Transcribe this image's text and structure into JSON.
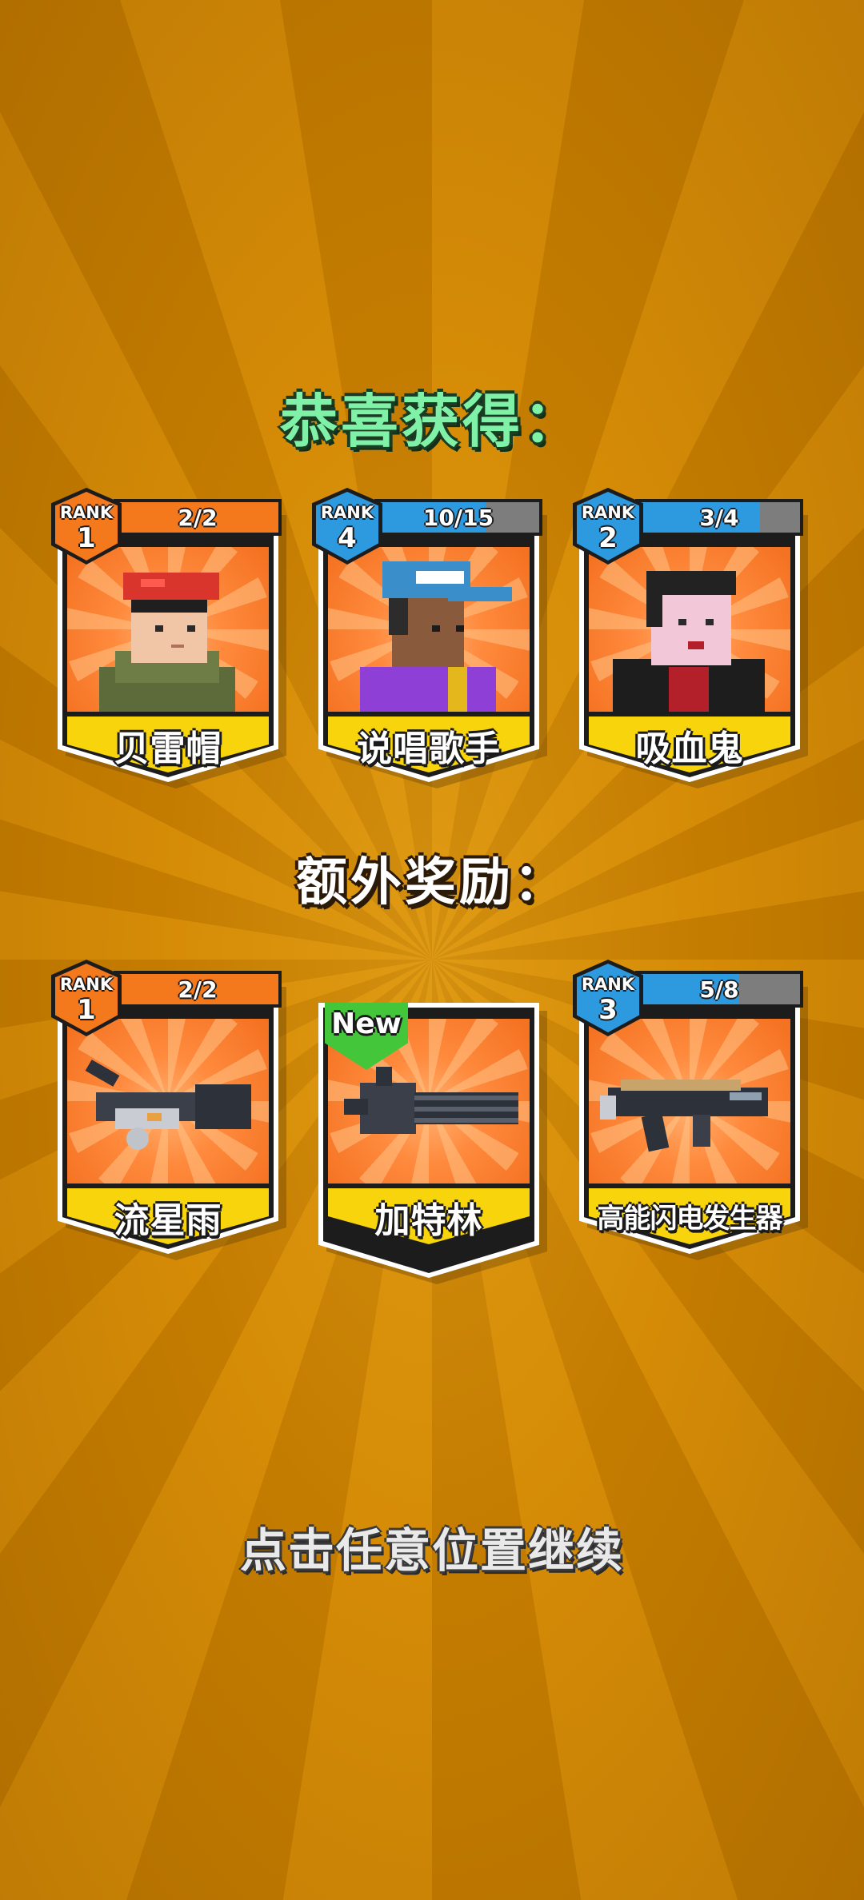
{
  "heading": "恭喜获得：",
  "bonus_heading": "额外奖励：",
  "continue_hint": "点击任意位置继续",
  "colors": {
    "orange_bar": "#f4781c",
    "blue_bar": "#2d9ae0",
    "name_plate": "#f7d40c",
    "new_badge": "#44c63b"
  },
  "rewards": [
    {
      "name": "贝雷帽",
      "rank_label": "RANK",
      "rank": "1",
      "progress": "2/2",
      "fraction": 1.0,
      "tier": "orange",
      "icon": "beret-soldier-icon"
    },
    {
      "name": "说唱歌手",
      "rank_label": "RANK",
      "rank": "4",
      "progress": "10/15",
      "fraction": 0.6667,
      "tier": "blue",
      "icon": "rapper-character-icon"
    },
    {
      "name": "吸血鬼",
      "rank_label": "RANK",
      "rank": "2",
      "progress": "3/4",
      "fraction": 0.75,
      "tier": "blue",
      "icon": "vampire-character-icon"
    }
  ],
  "bonus": [
    {
      "name": "流星雨",
      "rank_label": "RANK",
      "rank": "1",
      "progress": "2/2",
      "fraction": 1.0,
      "tier": "orange",
      "icon": "meteor-gun-icon"
    },
    {
      "name": "加特林",
      "new_label": "New",
      "icon": "gatling-gun-icon"
    },
    {
      "name": "高能闪电发生器",
      "rank_label": "RANK",
      "rank": "3",
      "progress": "5/8",
      "fraction": 0.625,
      "tier": "blue",
      "icon": "lightning-generator-icon"
    }
  ]
}
